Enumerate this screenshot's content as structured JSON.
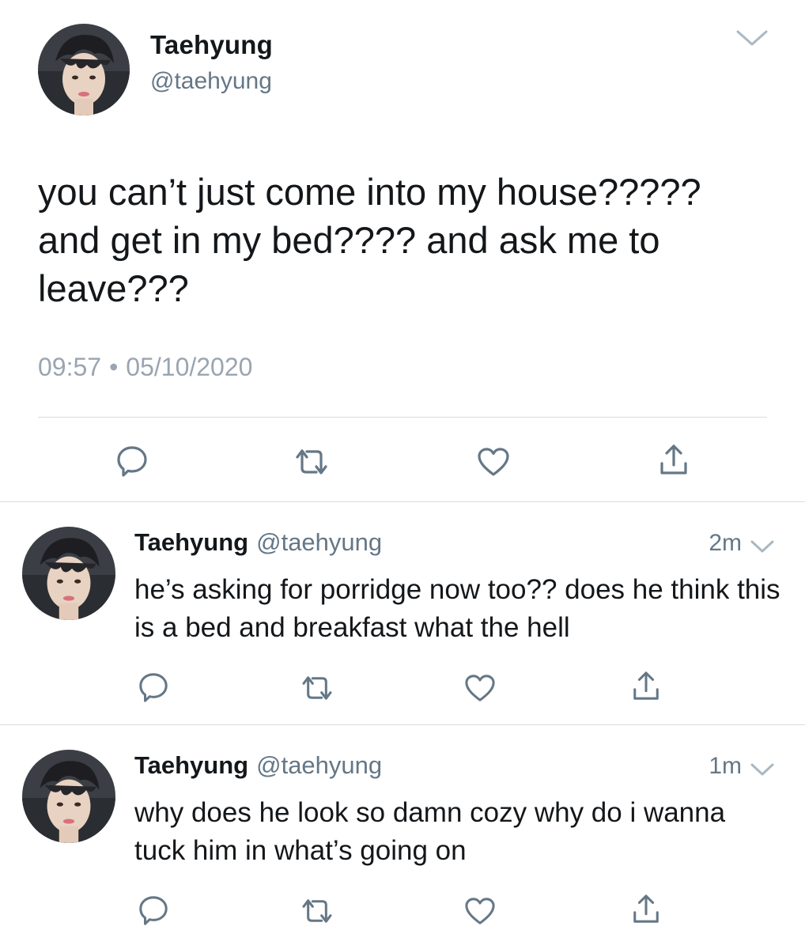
{
  "main_tweet": {
    "author_name": "Taehyung",
    "author_handle": "@taehyung",
    "text": "you can’t just come into my house????? and get in my bed???? and ask me to leave???",
    "time": "09:57",
    "separator": "•",
    "date": "05/10/2020",
    "actions": [
      "reply-icon",
      "retweet-icon",
      "like-icon",
      "share-icon"
    ]
  },
  "replies": [
    {
      "author_name": "Taehyung",
      "author_handle": "@taehyung",
      "time_ago": "2m",
      "text": "he’s asking for porridge now too?? does he think this is a bed and breakfast what the hell"
    },
    {
      "author_name": "Taehyung",
      "author_handle": "@taehyung",
      "time_ago": "1m",
      "text": "why does he look so damn cozy why do i wanna tuck him in what’s going on"
    }
  ],
  "colors": {
    "text_primary": "#14171a",
    "text_secondary": "#657786",
    "meta": "#9aa5b1",
    "icon": "#657786",
    "divider": "#d7dde2"
  }
}
